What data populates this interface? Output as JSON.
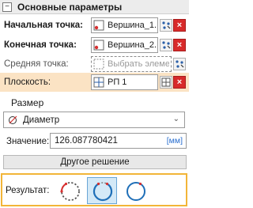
{
  "header": {
    "collapse_symbol": "−",
    "title": "Основные параметры"
  },
  "rows": {
    "start_label": "Начальная точка:",
    "start_value": "Вершина_1...",
    "end_label": "Конечная точка:",
    "end_value": "Вершина_2...",
    "mid_label": "Средняя точка:",
    "mid_placeholder": "Выбрать элемент",
    "plane_label": "Плоскость:",
    "plane_value": "РП 1",
    "clear_symbol": "×"
  },
  "size": {
    "section_title": "Размер",
    "type_selected": "Диаметр",
    "value_label": "Значение:",
    "value": "126.087780421",
    "unit": "[мм]"
  },
  "other_solution_label": "Другое решение",
  "result": {
    "label": "Результат:",
    "options": [
      {
        "name": "arc-option-1",
        "selected": false
      },
      {
        "name": "arc-option-2",
        "selected": true
      },
      {
        "name": "arc-option-3",
        "selected": false
      }
    ]
  },
  "colors": {
    "highlight_row": "#fbe3c4",
    "result_border": "#f2b538",
    "selected_option": "#d4e9f7",
    "clear_button": "#d82a2a",
    "unit_link": "#2a6fcf"
  }
}
